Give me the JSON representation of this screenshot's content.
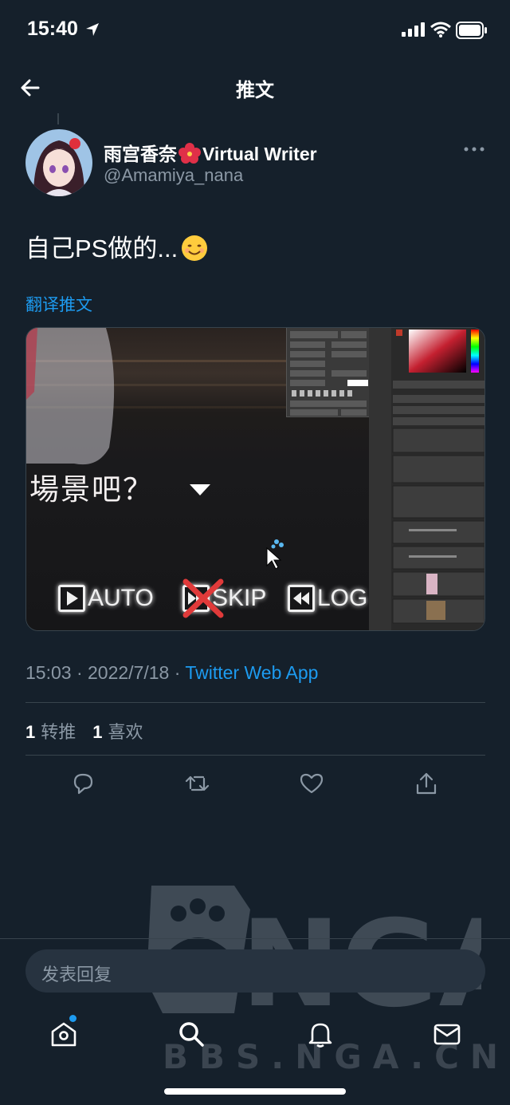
{
  "status_bar": {
    "time": "15:40"
  },
  "header": {
    "title": "推文"
  },
  "tweet": {
    "author_name": "雨宫香奈",
    "author_suffix": "Virtual Writer",
    "handle": "@Amamiya_nana",
    "text": "自己PS做的...",
    "translate_label": "翻译推文",
    "time": "15:03",
    "date": "2022/7/18",
    "separator": " · ",
    "source": "Twitter Web App",
    "retweets_count": "1",
    "retweets_label": "转推",
    "likes_count": "1",
    "likes_label": "喜欢"
  },
  "media": {
    "dialog_text": "場景吧？",
    "buttons": {
      "auto": "AUTO",
      "skip": "SKIP",
      "log": "LOG"
    }
  },
  "reply": {
    "placeholder": "发表回复"
  },
  "watermark": {
    "logo": "NGA",
    "domain": "BBS.NGA.CN"
  },
  "colors": {
    "background": "#15202b",
    "accent": "#1d9bf0",
    "secondary_text": "#8b98a5",
    "divider": "#38444d"
  },
  "icons": [
    "location-arrow-icon",
    "signal-icon",
    "wifi-icon",
    "battery-icon",
    "back-arrow-icon",
    "more-icon",
    "reply-icon",
    "retweet-icon",
    "like-icon",
    "share-icon",
    "home-icon",
    "search-icon",
    "bell-icon",
    "mail-icon"
  ]
}
